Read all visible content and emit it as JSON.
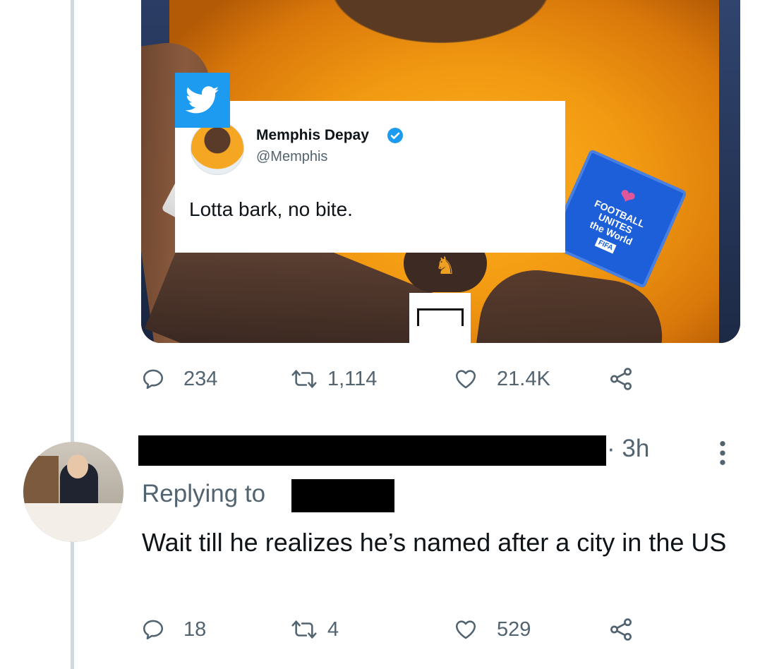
{
  "embedded_tweet": {
    "name": "Memphis Depay",
    "handle": "@Memphis",
    "text": "Lotta bark, no bite."
  },
  "badge_text": {
    "line1": "FOOTBALL",
    "line2": "UNITES",
    "line3": "the World",
    "line4": "FIFA"
  },
  "original_actions": {
    "replies": "234",
    "retweets": "1,114",
    "likes": "21.4K"
  },
  "reply": {
    "time": "· 3h",
    "replying_label": "Replying to",
    "text": "Wait till he realizes he’s named after a city in the US",
    "actions": {
      "replies": "18",
      "retweets": "4",
      "likes": "529"
    }
  },
  "colors": {
    "twitter_blue": "#1d9bf0",
    "muted_text": "#536471",
    "thread_line": "#cfd9de"
  },
  "icons": [
    "reply-icon",
    "retweet-icon",
    "like-icon",
    "share-icon",
    "verified-icon",
    "twitter-bird-icon",
    "more-icon"
  ]
}
